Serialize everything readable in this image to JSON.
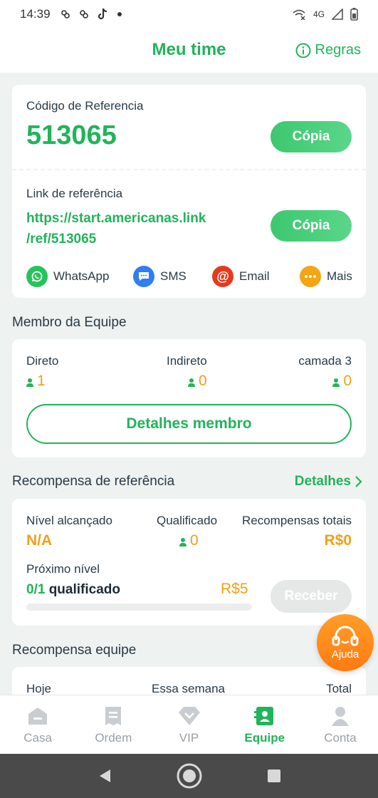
{
  "status_bar": {
    "time": "14:39",
    "network": "4G"
  },
  "header": {
    "title": "Meu time",
    "rules_label": "Regras"
  },
  "referral": {
    "code_label": "Código de Referencia",
    "code": "513065",
    "copy_label": "Cópia",
    "link_label": "Link de referência",
    "link_line1": "https://start.americanas.link",
    "link_line2": "/ref/513065",
    "share": [
      {
        "label": "WhatsApp",
        "icon": "whatsapp-icon",
        "color": "#25c45b"
      },
      {
        "label": "SMS",
        "icon": "sms-icon",
        "color": "#2f7ff0"
      },
      {
        "label": "Email",
        "icon": "email-icon",
        "color": "#e53a1c"
      },
      {
        "label": "Mais",
        "icon": "more-icon",
        "color": "#f5a415"
      }
    ]
  },
  "team": {
    "section_title": "Membro da Equipe",
    "columns": [
      {
        "label": "Direto",
        "value": "1"
      },
      {
        "label": "Indireto",
        "value": "0"
      },
      {
        "label": "camada 3",
        "value": "0"
      }
    ],
    "details_button": "Detalhes membro"
  },
  "referral_reward": {
    "section_title": "Recompensa de referência",
    "details_link": "Detalhes",
    "level_label": "Nível alcançado",
    "level_value": "N/A",
    "qualified_label": "Qualificado",
    "qualified_value": "0",
    "total_label": "Recompensas totais",
    "total_value": "R$0",
    "next_level_label": "Próximo nível",
    "progress_count": "0/1",
    "progress_text": "qualificado",
    "progress_fraction": 0,
    "next_reward": "R$5",
    "receive_button": "Receber"
  },
  "team_reward": {
    "section_title": "Recompensa equipe",
    "columns": [
      "Hoje",
      "Essa semana",
      "Total"
    ]
  },
  "help": {
    "label": "Ajuda"
  },
  "tabs": [
    {
      "label": "Casa",
      "icon": "home-icon",
      "active": false
    },
    {
      "label": "Ordem",
      "icon": "receipt-icon",
      "active": false
    },
    {
      "label": "VIP",
      "icon": "diamond-icon",
      "active": false
    },
    {
      "label": "Equipe",
      "icon": "team-icon",
      "active": true
    },
    {
      "label": "Conta",
      "icon": "account-icon",
      "active": false
    }
  ],
  "colors": {
    "brand": "#21b45a",
    "accent_orange": "#f0a01a",
    "help_orange": "#ff8a1a"
  }
}
